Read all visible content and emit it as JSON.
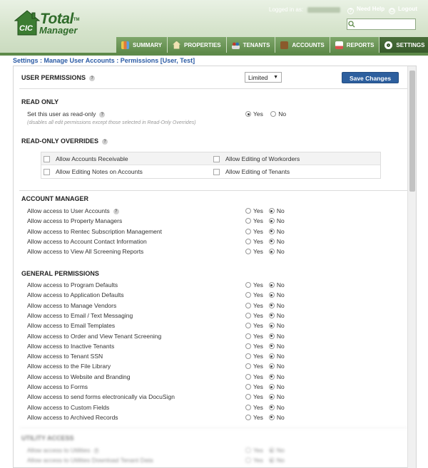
{
  "app": {
    "logo_cic": "CIC",
    "logo_line1": "Total",
    "logo_line2": "Manager",
    "logo_tm": "TM",
    "logged_in_label": "Logged in as:",
    "need_help": "Need Help",
    "logout": "Logout"
  },
  "nav": {
    "items": [
      {
        "label": "SUMMARY",
        "icon": "bar-chart-icon"
      },
      {
        "label": "PROPERTIES",
        "icon": "house-icon"
      },
      {
        "label": "TENANTS",
        "icon": "people-icon"
      },
      {
        "label": "ACCOUNTS",
        "icon": "ledger-icon"
      },
      {
        "label": "REPORTS",
        "icon": "report-icon"
      },
      {
        "label": "SETTINGS",
        "icon": "gear-icon"
      }
    ],
    "active": "SETTINGS"
  },
  "breadcrumb": "Settings : Manage User Accounts : Permissions [User, Test]",
  "page": {
    "user_permissions_label": "USER PERMISSIONS",
    "permission_select_value": "Limited",
    "save_label": "Save Changes"
  },
  "read_only": {
    "title": "READ ONLY",
    "row_label": "Set this user as read-only",
    "note": "(disables all edit permissions except those selected in Read-Only Overrides)",
    "selected": "Yes"
  },
  "overrides": {
    "title": "READ-ONLY OVERRIDES",
    "items": [
      "Allow Accounts Receivable",
      "Allow Editing of Workorders",
      "Allow Editing Notes on Accounts",
      "Allow Editing of Tenants"
    ]
  },
  "radio_labels": {
    "yes": "Yes",
    "no": "No"
  },
  "account_manager": {
    "title": "ACCOUNT MANAGER",
    "rows": [
      "Allow access to User Accounts",
      "Allow access to Property Managers",
      "Allow access to Rentec Subscription Management",
      "Allow access to Account Contact Information",
      "Allow access to View All Screening Reports"
    ]
  },
  "general": {
    "title": "GENERAL PERMISSIONS",
    "rows": [
      "Allow access to Program Defaults",
      "Allow access to Application Defaults",
      "Allow access to Manage Vendors",
      "Allow access to Email / Text Messaging",
      "Allow access to Email Templates",
      "Allow access to Order and View Tenant Screening",
      "Allow access to Inactive Tenants",
      "Allow access to Tenant SSN",
      "Allow access to the File Library",
      "Allow access to Website and Branding",
      "Allow access to Forms",
      "Allow access to send forms electronically via DocuSign",
      "Allow access to Custom Fields",
      "Allow access to Archived Records"
    ]
  },
  "utility": {
    "title": "UTILITY ACCESS",
    "rows": [
      "Allow access to Utilities",
      "Allow access to Utilities Download Tenant Data"
    ]
  },
  "colors": {
    "brand_green": "#2f6b2a",
    "nav_green": "#5e8a4a",
    "link_blue": "#2a5aa4",
    "button_blue": "#2d5f9e"
  }
}
